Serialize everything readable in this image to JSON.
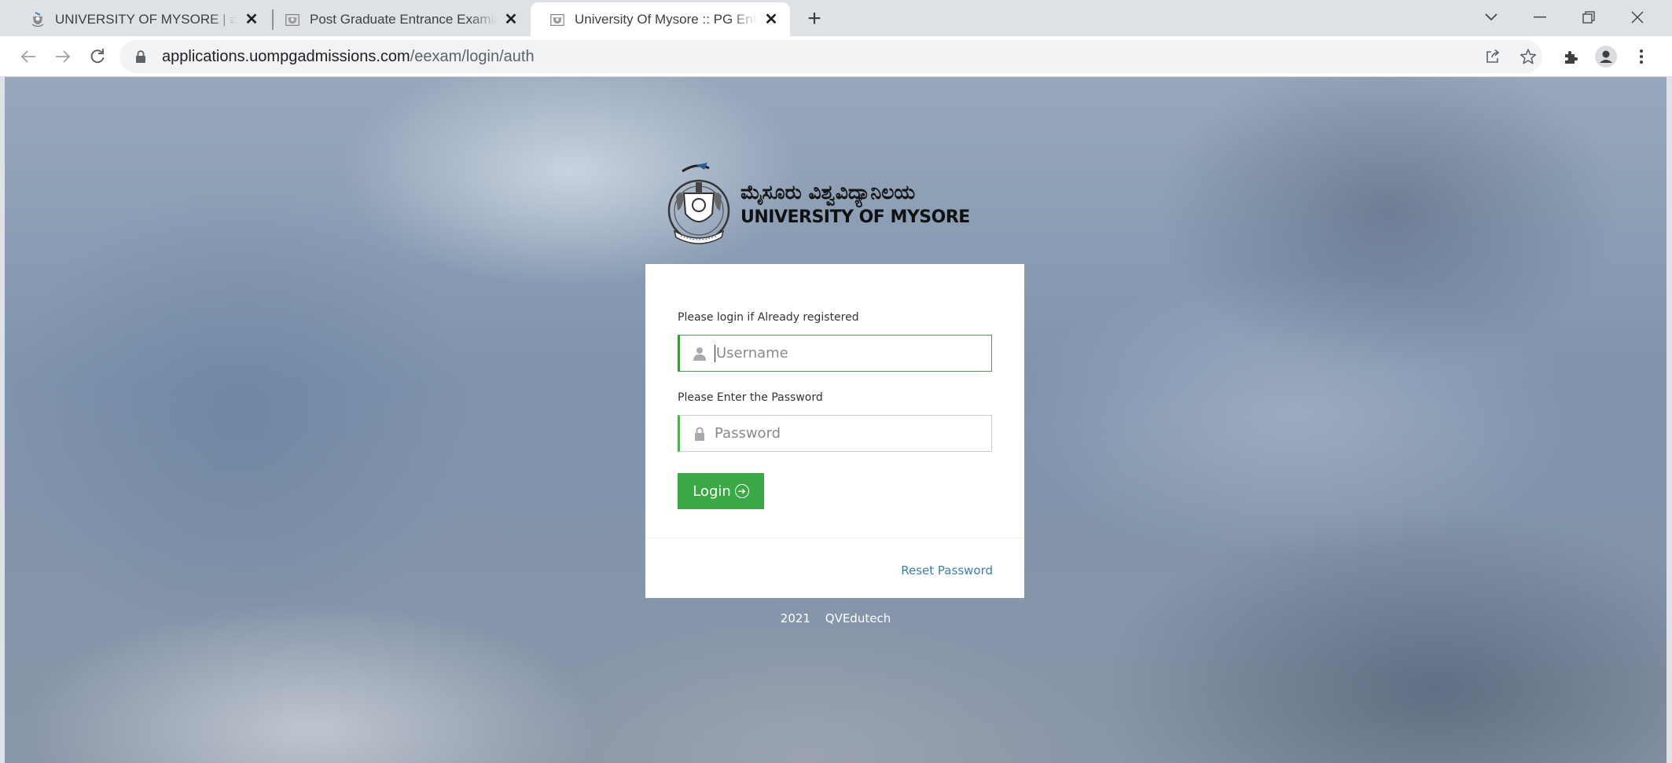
{
  "browser": {
    "tabs": [
      {
        "title": "UNIVERSITY OF MYSORE | ಮೈಸೂ",
        "active": false,
        "icon": "university-emblem-icon"
      },
      {
        "title": "Post Graduate Entrance Examinat",
        "active": false,
        "icon": "university-emblem-icon"
      },
      {
        "title": "University Of Mysore :: PG Entran",
        "active": true,
        "icon": "university-emblem-icon"
      }
    ],
    "new_tab_label": "+",
    "url_domain": "applications.uompgadmissions.com",
    "url_path": "/eexam/login/auth"
  },
  "logo": {
    "kannada_text": "ಮೈಸೂರು ವಿಶ್ವವಿದ್ಯಾನಿಲಯ",
    "english_text": "UNIVERSITY OF MYSORE"
  },
  "login_form": {
    "username_label": "Please login if Already registered",
    "username_placeholder": "Username",
    "username_value": "",
    "password_label": "Please Enter the Password",
    "password_placeholder": "Password",
    "password_value": "",
    "login_button": "Login",
    "reset_link": "Reset Password"
  },
  "footer": {
    "year": "2021",
    "company": "QVEdutech"
  },
  "colors": {
    "accent_green": "#3aa845",
    "link_blue": "#3c7ea8",
    "tabstrip_bg": "#dee1e6"
  }
}
